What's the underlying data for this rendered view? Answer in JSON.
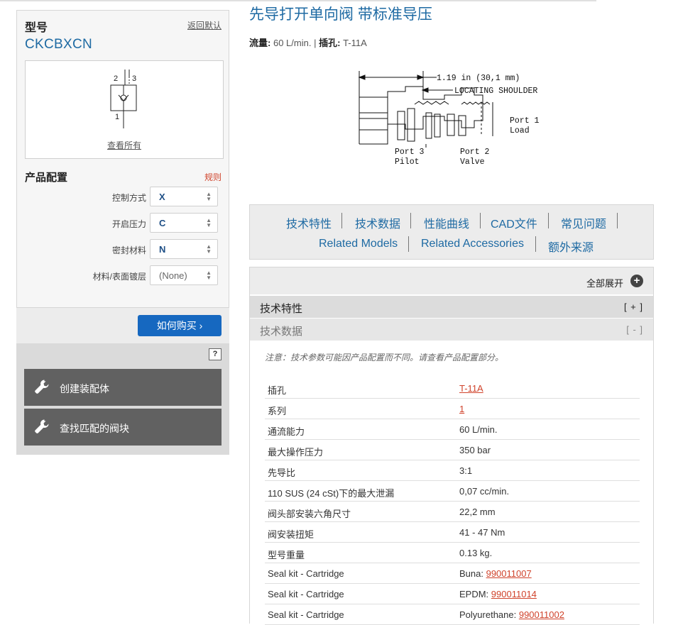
{
  "sidebar": {
    "model_label": "型号",
    "reset_label": "返回默认",
    "model_code": "CKCBXCN",
    "symbol": {
      "port_left": "2",
      "port_right": "3",
      "port_bottom": "1"
    },
    "view_all": "查看所有",
    "config_title": "产品配置",
    "rules_label": "规则",
    "config": [
      {
        "label": "控制方式",
        "value": "X"
      },
      {
        "label": "开启压力",
        "value": "C"
      },
      {
        "label": "密封材料",
        "value": "N"
      },
      {
        "label": "材料/表面镀层",
        "value": "(None)"
      }
    ],
    "buy_label": "如何购买",
    "buy_chevron": "›",
    "help_label": "?",
    "actions": [
      {
        "label": "创建装配体",
        "icon": "wrench-icon"
      },
      {
        "label": "查找匹配的阀块",
        "icon": "wrench-icon"
      }
    ]
  },
  "header": {
    "title": "先导打开单向阀 带标准导压",
    "flow_label": "流量:",
    "flow_value": "60 L/min.",
    "divider": "|",
    "cavity_label": "插孔:",
    "cavity_value": "T-11A"
  },
  "diagram": {
    "dimension": "1.19 in (30,1 mm)",
    "shoulder": "LOCATING SHOULDER",
    "port1_a": "Port 1",
    "port1_b": "Load",
    "port3_a": "Port 3",
    "port3_b": "Pilot",
    "port2_a": "Port 2",
    "port2_b": "Valve"
  },
  "tabs": [
    "技术特性",
    "技术数据",
    "性能曲线",
    "CAD文件",
    "常见问题",
    "Related Models",
    "Related Accessories",
    "额外来源"
  ],
  "details": {
    "expand_all": "全部展开",
    "expand_icon": "+",
    "sections": [
      {
        "label": "技术特性",
        "toggle": "[ + ]"
      },
      {
        "label": "技术数据",
        "toggle": "[ - ]"
      }
    ],
    "note": "注意：技术参数可能因产品配置而不同。请查看产品配置部分。",
    "rows": [
      {
        "key": "插孔",
        "value": "",
        "link": "T-11A"
      },
      {
        "key": "系列",
        "value": "",
        "link": "1"
      },
      {
        "key": "通流能力",
        "value": "60 L/min.",
        "link": ""
      },
      {
        "key": "最大操作压力",
        "value": "350 bar",
        "link": ""
      },
      {
        "key": "先导比",
        "value": "3:1",
        "link": ""
      },
      {
        "key": "110 SUS (24 cSt)下的最大泄漏",
        "value": "0,07 cc/min.",
        "link": ""
      },
      {
        "key": "阀头部安装六角尺寸",
        "value": "22,2 mm",
        "link": ""
      },
      {
        "key": "阀安装扭矩",
        "value": "41 - 47 Nm",
        "link": ""
      },
      {
        "key": "型号重量",
        "value": "0.13 kg.",
        "link": ""
      },
      {
        "key": "Seal kit - Cartridge",
        "value": "Buna: ",
        "link": "990011007"
      },
      {
        "key": "Seal kit - Cartridge",
        "value": "EPDM: ",
        "link": "990011014"
      },
      {
        "key": "Seal kit - Cartridge",
        "value": "Polyurethane: ",
        "link": "990011002"
      }
    ]
  },
  "colors": {
    "accent": "#1e6aa3",
    "link": "#d0432b",
    "buy": "#1668c0",
    "action": "#616161"
  }
}
